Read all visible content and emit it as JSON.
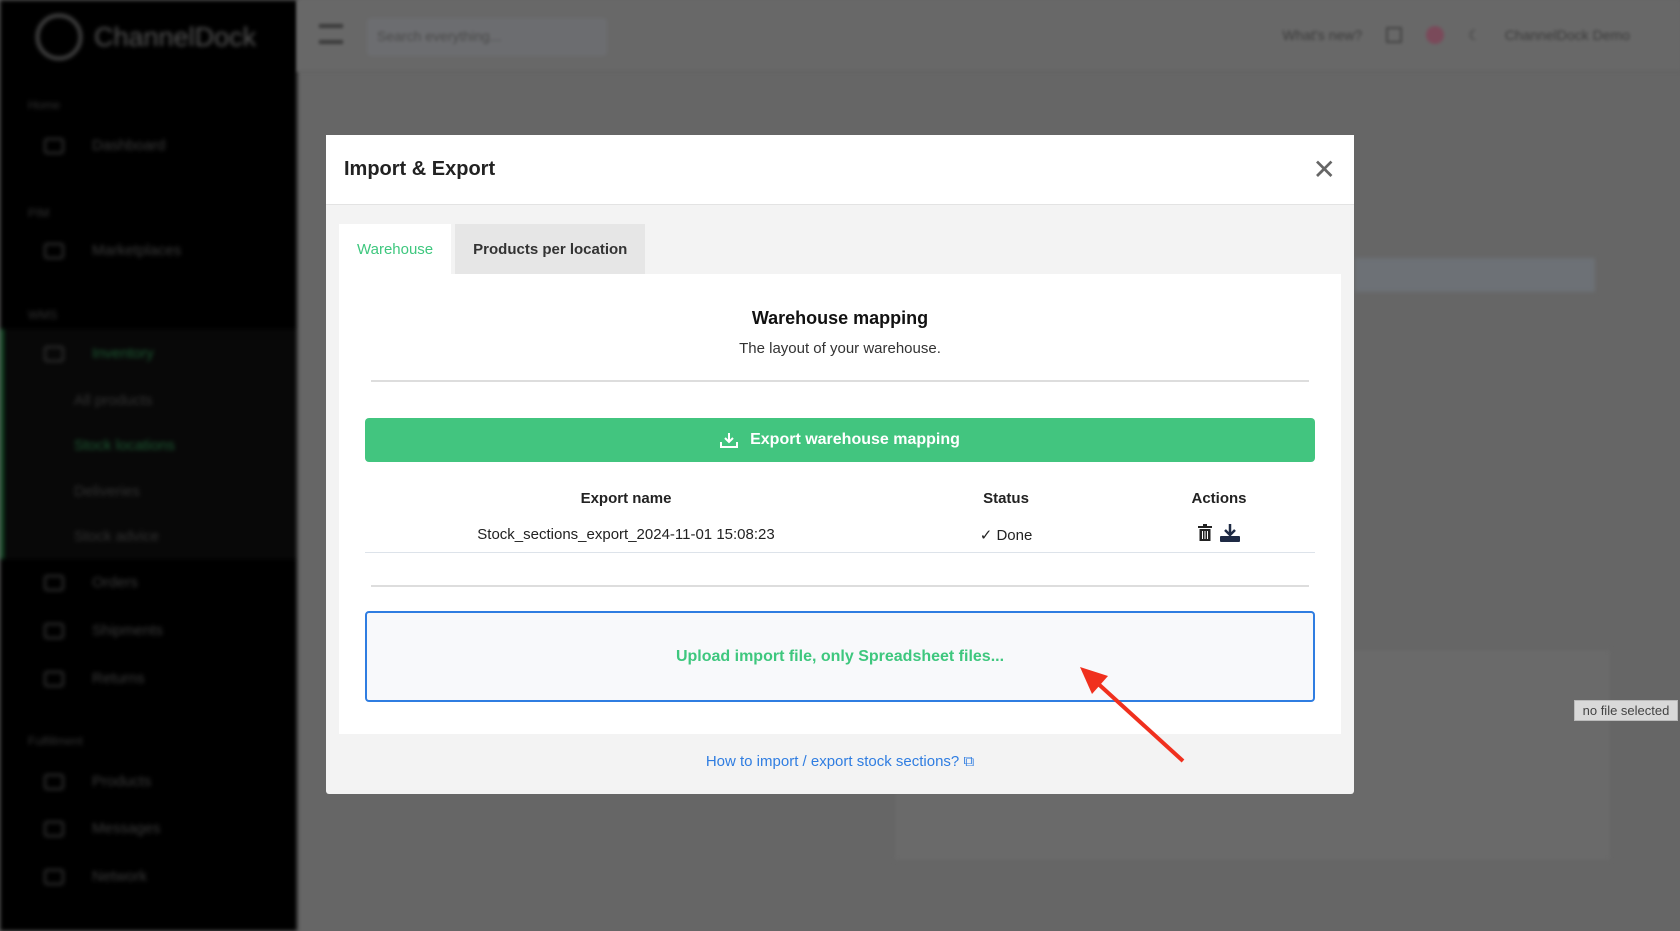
{
  "sidebar": {
    "brand": "ChannelDock",
    "sections": [
      "Home",
      "PIM",
      "WMS",
      "Fulfillment"
    ],
    "items": [
      {
        "label": "Dashboard"
      },
      {
        "label": "Marketplaces"
      },
      {
        "label": "Inventory"
      },
      {
        "label": "Orders"
      },
      {
        "label": "Shipments"
      },
      {
        "label": "Returns"
      },
      {
        "label": "Products"
      },
      {
        "label": "Messages"
      },
      {
        "label": "Network"
      }
    ],
    "inventory_sub": [
      "All products",
      "Stock locations",
      "Deliveries",
      "Stock advice"
    ]
  },
  "topbar": {
    "search_placeholder": "Search everything...",
    "whats_new": "What's new?",
    "user": "ChannelDock Demo"
  },
  "modal": {
    "title": "Import & Export",
    "tabs": [
      {
        "label": "Warehouse",
        "active": true
      },
      {
        "label": "Products per location",
        "active": false
      }
    ],
    "heading": "Warehouse mapping",
    "subtitle": "The layout of your warehouse.",
    "export_button": "Export warehouse mapping",
    "table": {
      "headers": [
        "Export name",
        "Status",
        "Actions"
      ],
      "rows": [
        {
          "name": "Stock_sections_export_2024-11-01 15:08:23",
          "status": "Done"
        }
      ]
    },
    "upload_label": "Upload import file, only Spreadsheet files...",
    "help_link": "How to import / export stock sections?"
  },
  "tooltip": "no file selected",
  "colors": {
    "accent": "#42c57f",
    "link": "#2f7de1",
    "arrow": "#f0301e"
  }
}
